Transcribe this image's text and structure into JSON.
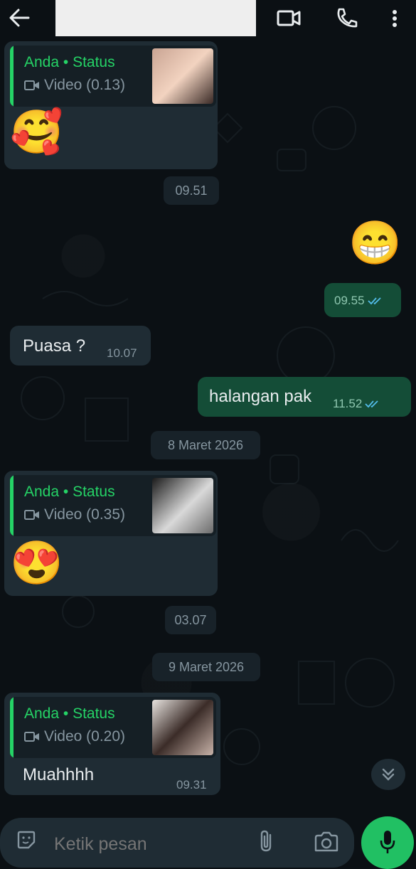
{
  "header": {
    "back_icon": "arrow-left-icon",
    "video_call_icon": "video-camera-icon",
    "voice_call_icon": "phone-icon",
    "menu_icon": "more-vertical-icon"
  },
  "messages": {
    "m1": {
      "quote_title": "Anda • Status",
      "quote_sub": "Video (0.13)"
    },
    "chip1": "09.51",
    "m3_time": "09.55",
    "m4": {
      "text": "Puasa ?",
      "time": "10.07"
    },
    "m5": {
      "text": "halangan pak",
      "time": "11.52"
    },
    "date1": "8 Maret 2026",
    "m6": {
      "quote_title": "Anda • Status",
      "quote_sub": "Video (0.35)"
    },
    "chip2": "03.07",
    "date2": "9 Maret 2026",
    "m8": {
      "quote_title": "Anda • Status",
      "quote_sub": "Video (0.20)",
      "text": "Muahhhh",
      "time": "09.31"
    }
  },
  "composer": {
    "placeholder": "Ketik pesan",
    "sticker_icon": "sticker-icon",
    "attach_icon": "paperclip-icon",
    "camera_icon": "camera-icon",
    "mic_icon": "microphone-icon"
  },
  "colors": {
    "accent_green": "#25d366",
    "outgoing_bubble": "#144d37",
    "incoming_bubble": "#1f2c34",
    "read_ticks": "#53bdeb"
  }
}
